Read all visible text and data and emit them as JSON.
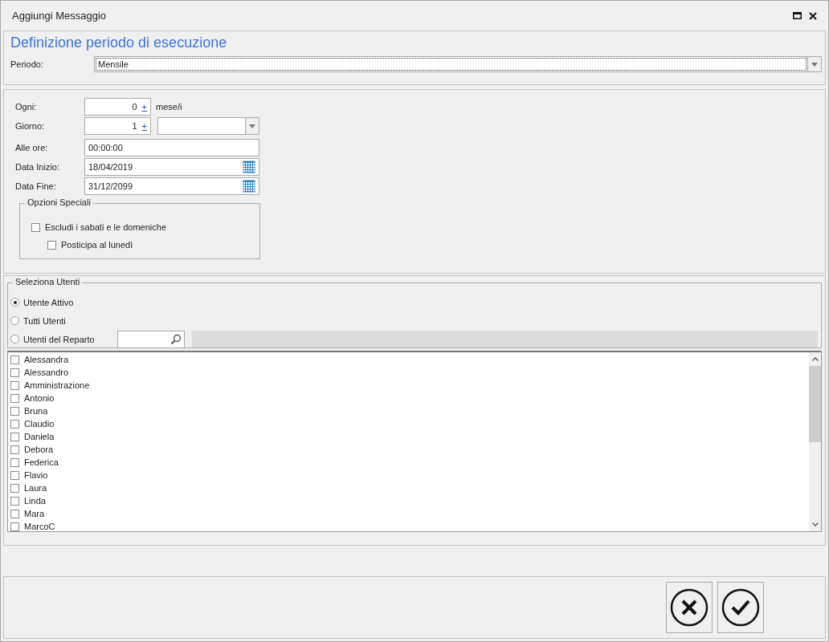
{
  "window": {
    "title": "Aggiungi Messaggio"
  },
  "header": {
    "title": "Definizione periodo di esecuzione",
    "periodo": {
      "label": "Periodo:",
      "value": "Mensile"
    }
  },
  "schedule": {
    "ogni": {
      "label": "Ogni:",
      "value": "0",
      "spin": "+",
      "unit": "mese/i"
    },
    "giorno": {
      "label": "Giorno:",
      "value": "1",
      "spin": "+"
    },
    "ore": {
      "label": "Alle ore:",
      "value": "00:00:00"
    },
    "data_inizio": {
      "label": "Data Inizio:",
      "value": "18/04/2019"
    },
    "data_fine": {
      "label": "Data Fine:",
      "value": "31/12/2099"
    },
    "special": {
      "title": "Opzioni Speciali",
      "options": [
        {
          "label": "Escludi i sabati e le domeniche",
          "checked": false,
          "children": [
            {
              "label": "Posticipa al lunedì",
              "checked": false
            }
          ]
        }
      ]
    }
  },
  "users": {
    "title": "Seleziona Utenti",
    "modes": [
      {
        "label": "Utente Attivo",
        "selected": true
      },
      {
        "label": "Tutti Utenti",
        "selected": false
      },
      {
        "label": "Utenti del Reparto",
        "selected": false,
        "kind": "search"
      }
    ],
    "list": [
      {
        "name": "Alessandra",
        "checked": false
      },
      {
        "name": "Alessandro",
        "checked": false
      },
      {
        "name": "Amministrazione",
        "checked": false
      },
      {
        "name": "Antonio",
        "checked": false
      },
      {
        "name": "Bruna",
        "checked": false
      },
      {
        "name": "Claudio",
        "checked": false
      },
      {
        "name": "Daniela",
        "checked": false
      },
      {
        "name": "Debora",
        "checked": false
      },
      {
        "name": "Federica",
        "checked": false
      },
      {
        "name": "Flavio",
        "checked": false
      },
      {
        "name": "Laura",
        "checked": false
      },
      {
        "name": "Linda",
        "checked": false
      },
      {
        "name": "Mara",
        "checked": false
      },
      {
        "name": "MarcoC",
        "checked": false
      }
    ]
  },
  "buttons": [
    {
      "kind": "cancel"
    },
    {
      "kind": "confirm"
    }
  ]
}
